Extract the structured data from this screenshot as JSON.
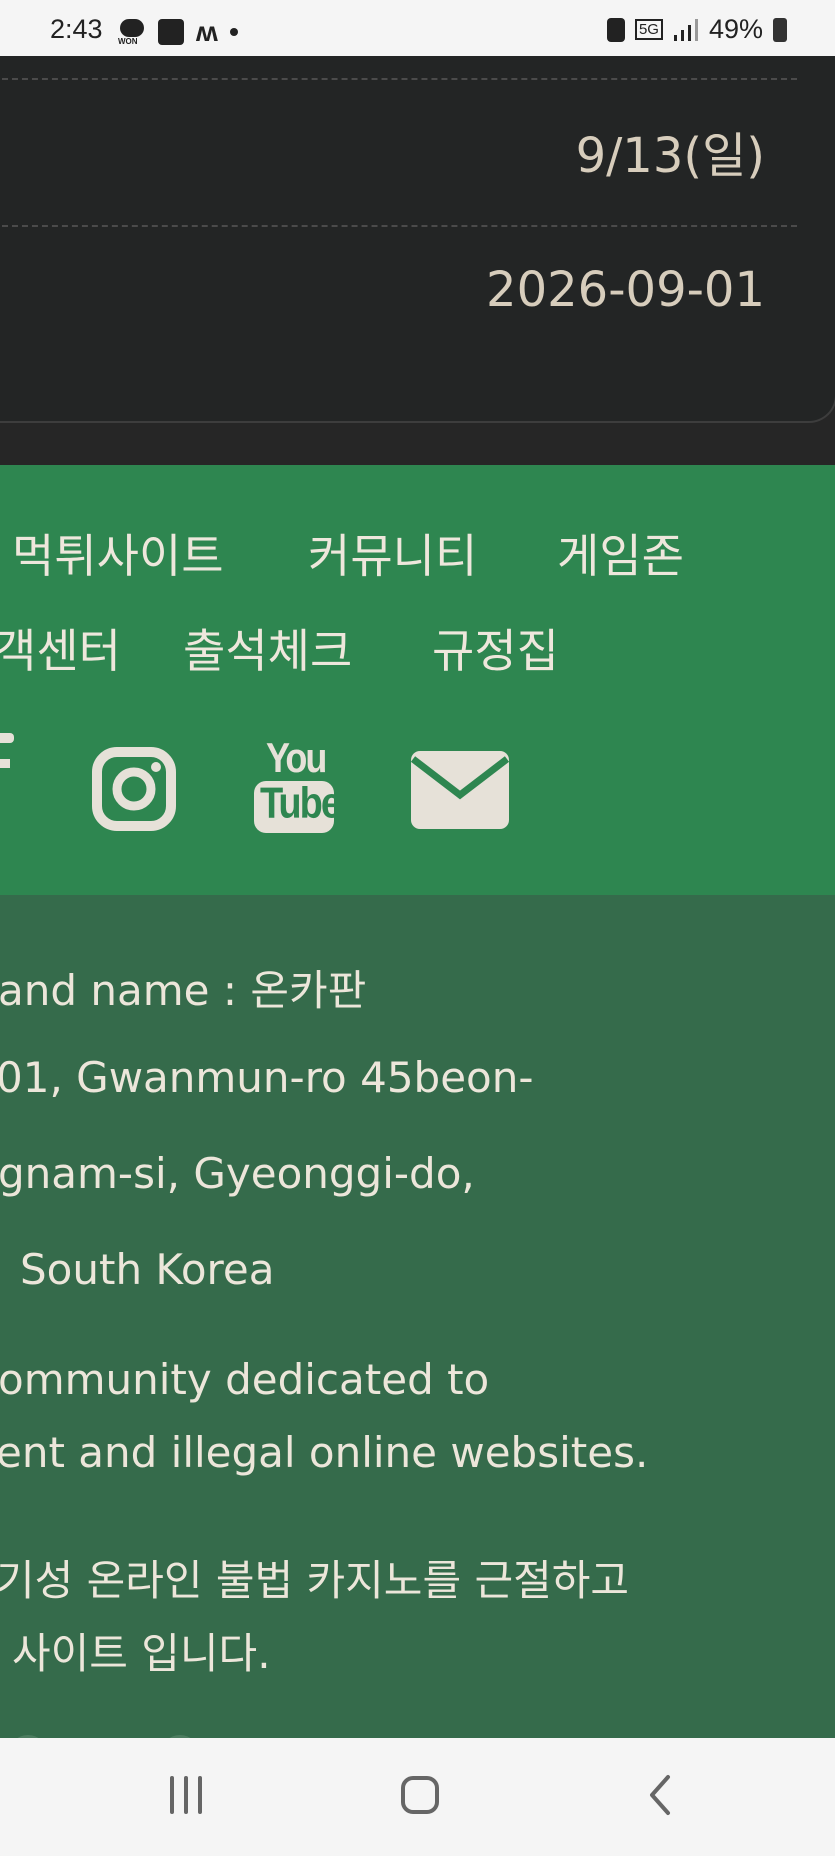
{
  "status_bar": {
    "time": "2:43",
    "won_label": "WON",
    "battery": "49%",
    "network": "5G"
  },
  "card": {
    "row1_value": "9/13(일)",
    "row2_value": "2026-09-01"
  },
  "nav": {
    "items": [
      "먹튀사이트",
      "커뮤니티",
      "게임존",
      "객센터",
      "출석체크",
      "규정집"
    ]
  },
  "social": {
    "facebook_fragment": "f",
    "youtube_top": "You",
    "youtube_bottom": "Tube"
  },
  "info": {
    "lines": [
      "and name : 온카판",
      "01, Gwanmun-ro 45beon-",
      "gnam-si, Gyeonggi-do,",
      "South Korea",
      "ommunity dedicated to",
      "ent and illegal online websites.",
      "기성 온라인 불법 카지노를 근절하고",
      "사이트 입니다."
    ]
  },
  "colors": {
    "dark_card": "#232525",
    "nav_green": "#2e8650",
    "info_green": "#356b4b",
    "text_cream": "#ece6da"
  }
}
